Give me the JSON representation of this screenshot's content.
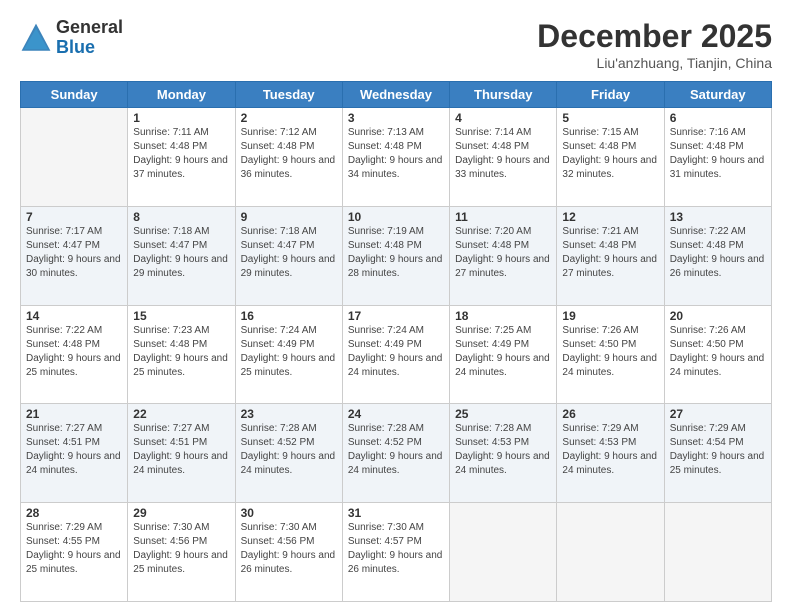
{
  "header": {
    "logo": {
      "line1": "General",
      "line2": "Blue"
    },
    "title": "December 2025",
    "location": "Liu'anzhuang, Tianjin, China"
  },
  "weekdays": [
    "Sunday",
    "Monday",
    "Tuesday",
    "Wednesday",
    "Thursday",
    "Friday",
    "Saturday"
  ],
  "weeks": [
    [
      {
        "day": "",
        "empty": true
      },
      {
        "day": "1",
        "sunrise": "7:11 AM",
        "sunset": "4:48 PM",
        "daylight": "9 hours and 37 minutes."
      },
      {
        "day": "2",
        "sunrise": "7:12 AM",
        "sunset": "4:48 PM",
        "daylight": "9 hours and 36 minutes."
      },
      {
        "day": "3",
        "sunrise": "7:13 AM",
        "sunset": "4:48 PM",
        "daylight": "9 hours and 34 minutes."
      },
      {
        "day": "4",
        "sunrise": "7:14 AM",
        "sunset": "4:48 PM",
        "daylight": "9 hours and 33 minutes."
      },
      {
        "day": "5",
        "sunrise": "7:15 AM",
        "sunset": "4:48 PM",
        "daylight": "9 hours and 32 minutes."
      },
      {
        "day": "6",
        "sunrise": "7:16 AM",
        "sunset": "4:48 PM",
        "daylight": "9 hours and 31 minutes."
      }
    ],
    [
      {
        "day": "7",
        "sunrise": "7:17 AM",
        "sunset": "4:47 PM",
        "daylight": "9 hours and 30 minutes."
      },
      {
        "day": "8",
        "sunrise": "7:18 AM",
        "sunset": "4:47 PM",
        "daylight": "9 hours and 29 minutes."
      },
      {
        "day": "9",
        "sunrise": "7:18 AM",
        "sunset": "4:47 PM",
        "daylight": "9 hours and 29 minutes."
      },
      {
        "day": "10",
        "sunrise": "7:19 AM",
        "sunset": "4:48 PM",
        "daylight": "9 hours and 28 minutes."
      },
      {
        "day": "11",
        "sunrise": "7:20 AM",
        "sunset": "4:48 PM",
        "daylight": "9 hours and 27 minutes."
      },
      {
        "day": "12",
        "sunrise": "7:21 AM",
        "sunset": "4:48 PM",
        "daylight": "9 hours and 27 minutes."
      },
      {
        "day": "13",
        "sunrise": "7:22 AM",
        "sunset": "4:48 PM",
        "daylight": "9 hours and 26 minutes."
      }
    ],
    [
      {
        "day": "14",
        "sunrise": "7:22 AM",
        "sunset": "4:48 PM",
        "daylight": "9 hours and 25 minutes."
      },
      {
        "day": "15",
        "sunrise": "7:23 AM",
        "sunset": "4:48 PM",
        "daylight": "9 hours and 25 minutes."
      },
      {
        "day": "16",
        "sunrise": "7:24 AM",
        "sunset": "4:49 PM",
        "daylight": "9 hours and 25 minutes."
      },
      {
        "day": "17",
        "sunrise": "7:24 AM",
        "sunset": "4:49 PM",
        "daylight": "9 hours and 24 minutes."
      },
      {
        "day": "18",
        "sunrise": "7:25 AM",
        "sunset": "4:49 PM",
        "daylight": "9 hours and 24 minutes."
      },
      {
        "day": "19",
        "sunrise": "7:26 AM",
        "sunset": "4:50 PM",
        "daylight": "9 hours and 24 minutes."
      },
      {
        "day": "20",
        "sunrise": "7:26 AM",
        "sunset": "4:50 PM",
        "daylight": "9 hours and 24 minutes."
      }
    ],
    [
      {
        "day": "21",
        "sunrise": "7:27 AM",
        "sunset": "4:51 PM",
        "daylight": "9 hours and 24 minutes."
      },
      {
        "day": "22",
        "sunrise": "7:27 AM",
        "sunset": "4:51 PM",
        "daylight": "9 hours and 24 minutes."
      },
      {
        "day": "23",
        "sunrise": "7:28 AM",
        "sunset": "4:52 PM",
        "daylight": "9 hours and 24 minutes."
      },
      {
        "day": "24",
        "sunrise": "7:28 AM",
        "sunset": "4:52 PM",
        "daylight": "9 hours and 24 minutes."
      },
      {
        "day": "25",
        "sunrise": "7:28 AM",
        "sunset": "4:53 PM",
        "daylight": "9 hours and 24 minutes."
      },
      {
        "day": "26",
        "sunrise": "7:29 AM",
        "sunset": "4:53 PM",
        "daylight": "9 hours and 24 minutes."
      },
      {
        "day": "27",
        "sunrise": "7:29 AM",
        "sunset": "4:54 PM",
        "daylight": "9 hours and 25 minutes."
      }
    ],
    [
      {
        "day": "28",
        "sunrise": "7:29 AM",
        "sunset": "4:55 PM",
        "daylight": "9 hours and 25 minutes."
      },
      {
        "day": "29",
        "sunrise": "7:30 AM",
        "sunset": "4:56 PM",
        "daylight": "9 hours and 25 minutes."
      },
      {
        "day": "30",
        "sunrise": "7:30 AM",
        "sunset": "4:56 PM",
        "daylight": "9 hours and 26 minutes."
      },
      {
        "day": "31",
        "sunrise": "7:30 AM",
        "sunset": "4:57 PM",
        "daylight": "9 hours and 26 minutes."
      },
      {
        "day": "",
        "empty": true
      },
      {
        "day": "",
        "empty": true
      },
      {
        "day": "",
        "empty": true
      }
    ]
  ],
  "labels": {
    "sunrise_prefix": "Sunrise: ",
    "sunset_prefix": "Sunset: ",
    "daylight_prefix": "Daylight: "
  }
}
